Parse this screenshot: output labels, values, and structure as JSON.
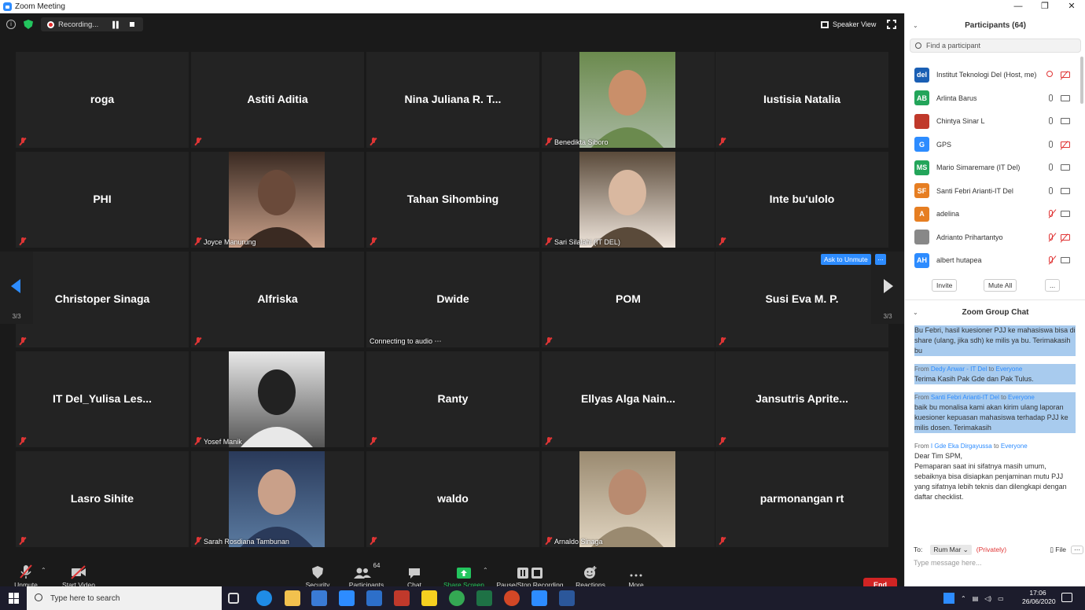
{
  "window": {
    "title": "Zoom Meeting",
    "controls": [
      "—",
      "❐",
      "✕"
    ]
  },
  "topbar": {
    "recording_label": "Recording...",
    "speaker_view": "Speaker View"
  },
  "tiles": [
    {
      "name": "roga",
      "label": "",
      "has_video": false
    },
    {
      "name": "Astiti Aditia",
      "label": "",
      "has_video": false
    },
    {
      "name": "Nina Juliana R. T...",
      "label": "",
      "has_video": false
    },
    {
      "name": "",
      "label": "Benedikta Siboro",
      "has_video": true
    },
    {
      "name": "Iustisia Natalia",
      "label": "",
      "has_video": false
    },
    {
      "name": "PHI",
      "label": "",
      "has_video": false
    },
    {
      "name": "",
      "label": "Joyce Manurung",
      "has_video": true
    },
    {
      "name": "Tahan Sihombing",
      "label": "",
      "has_video": false
    },
    {
      "name": "",
      "label": "Sari Silalahi (IT DEL)",
      "has_video": true
    },
    {
      "name": "Inte bu'ulolo",
      "label": "",
      "has_video": false
    },
    {
      "name": "Christoper Sinaga",
      "label": "",
      "has_video": false
    },
    {
      "name": "Alfriska",
      "label": "",
      "has_video": false
    },
    {
      "name": "Dwide",
      "label": "Connecting to audio ⋯",
      "has_video": false
    },
    {
      "name": "POM",
      "label": "",
      "has_video": false
    },
    {
      "name": "Susi Eva M. P.",
      "label": "",
      "has_video": false
    },
    {
      "name": "IT Del_Yulisa Les...",
      "label": "",
      "has_video": false
    },
    {
      "name": "",
      "label": "Yosef Manik",
      "has_video": true
    },
    {
      "name": "Ranty",
      "label": "",
      "has_video": false
    },
    {
      "name": "Ellyas Alga Nain...",
      "label": "",
      "has_video": false
    },
    {
      "name": "Jansutris Aprite...",
      "label": "",
      "has_video": false
    },
    {
      "name": "Lasro Sihite",
      "label": "",
      "has_video": false
    },
    {
      "name": "",
      "label": "Sarah Rosdiana Tambunan",
      "has_video": true
    },
    {
      "name": "waldo",
      "label": "",
      "has_video": false
    },
    {
      "name": "",
      "label": "Arnaldo Sinaga",
      "has_video": true
    },
    {
      "name": "parmonangan rt",
      "label": "",
      "has_video": false
    }
  ],
  "paging": {
    "left": "3/3",
    "right": "3/3"
  },
  "ask_to_unmute": "Ask to Unmute",
  "ask_more": "...",
  "toolbar": {
    "unmute": "Unmute",
    "start_video": "Start Video",
    "security": "Security",
    "participants": "Participants",
    "participants_count": "64",
    "chat": "Chat",
    "share_screen": "Share Screen",
    "recording": "Pause/Stop Recording",
    "reactions": "Reactions",
    "more": "More",
    "end": "End"
  },
  "panel": {
    "participants_title": "Participants (64)",
    "search_placeholder": "Find a participant",
    "participants": [
      {
        "name": "Institut Teknologi Del (Host, me)",
        "initials": "del",
        "color": "#1a5fb4",
        "mic": "rec",
        "cam": "off"
      },
      {
        "name": "Arlinta Barus",
        "initials": "AB",
        "color": "#23a55a",
        "mic": "on",
        "cam": "on"
      },
      {
        "name": "Chintya Sinar L",
        "initials": "",
        "color": "#c0392b",
        "mic": "on",
        "cam": "on"
      },
      {
        "name": "GPS",
        "initials": "G",
        "color": "#2d8cff",
        "mic": "on",
        "cam": "off"
      },
      {
        "name": "Mario Simaremare (IT Del)",
        "initials": "MS",
        "color": "#23a55a",
        "mic": "on",
        "cam": "on"
      },
      {
        "name": "Santi Febri Arianti-IT Del",
        "initials": "SF",
        "color": "#e67e22",
        "mic": "on",
        "cam": "on"
      },
      {
        "name": "adelina",
        "initials": "A",
        "color": "#e67e22",
        "mic": "off",
        "cam": "on"
      },
      {
        "name": "Adrianto Prihartantyo",
        "initials": "",
        "color": "#888888",
        "mic": "off",
        "cam": "off"
      },
      {
        "name": "albert hutapea",
        "initials": "AH",
        "color": "#2d8cff",
        "mic": "off",
        "cam": "on"
      }
    ],
    "invite": "Invite",
    "mute_all": "Mute All",
    "more": "...",
    "chat_title": "Zoom Group Chat",
    "chat_messages": [
      {
        "from": "",
        "to": "",
        "text": "Bu Febri, hasil kuesioner PJJ ke mahasiswa bisa di share (ulang, jika sdh) ke milis ya bu. Terimakasih  bu",
        "highlight": true
      },
      {
        "from": "Dedy Anwar - IT Del",
        "to": "Everyone",
        "text": "Terima Kasih Pak Gde dan Pak Tulus.",
        "highlight": true
      },
      {
        "from": "Santi Febri Arianti-IT Del",
        "to": "Everyone",
        "text": "baik bu monalisa kami akan kirim ulang laporan kuesioner kepuasan mahasiswa terhadap PJJ ke milis dosen. Terimakasih",
        "highlight": true
      },
      {
        "from": "I Gde Eka Dirgayussa",
        "to": "Everyone",
        "text": "Dear Tim SPM,\nPemaparan saat ini sifatnya masih umum, sebaiknya bisa disiapkan penjaminan mutu PJJ yang sifatnya lebih teknis dan dilengkapi dengan daftar checklist.",
        "highlight": false
      }
    ],
    "from_word": "From",
    "to_word": "to",
    "to_label": "To:",
    "to_select": "Rum Mar ⌄",
    "privately": "(Privately)",
    "file": "File",
    "input_placeholder": "Type message here..."
  },
  "taskbar": {
    "search": "Type here to search",
    "time": "17:06",
    "date": "26/06/2020"
  }
}
